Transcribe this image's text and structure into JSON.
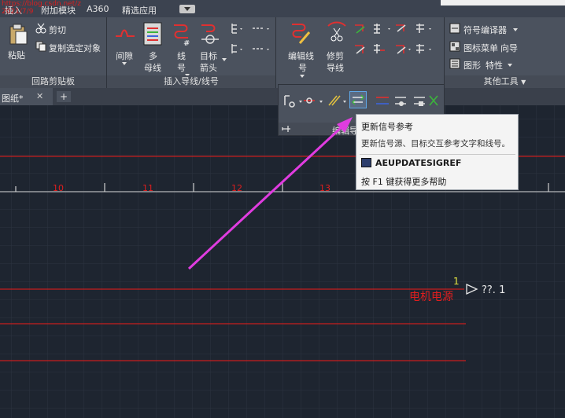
{
  "tabs": {
    "items": [
      "插入",
      "附加模块",
      "A360",
      "精选应用"
    ],
    "watermark_line1": "https://blog.csdn.net/z",
    "watermark_line2": "2021/7/9"
  },
  "ribbon": {
    "clipboard": {
      "paste": "粘贴",
      "cut": "剪切",
      "copy_selection": "复制选定对象",
      "title": "回路剪贴板"
    },
    "insert_wires": {
      "gap": "间隙",
      "multi_bus_1": "多",
      "multi_bus_2": "母线",
      "wire_1": "线",
      "wire_2": "号",
      "target_1": "目标",
      "target_2": "箭头",
      "title": "插入导线/线号"
    },
    "edit_wires": {
      "edit_wire_1": "编辑线",
      "edit_wire_2": "号",
      "trim_1": "修剪",
      "trim_2": "导线",
      "title": "编辑导线/线号"
    },
    "other_tools": {
      "symbol_builder": "符号编译器",
      "icon_menu": "图标菜单",
      "wizard": "向导",
      "properties_1": "图形",
      "properties_2": "特性",
      "title": "其他工具"
    }
  },
  "doc_tab": {
    "label": "图纸*",
    "close": "✕",
    "new": "+"
  },
  "flyout": {
    "title": "编辑导"
  },
  "tooltip": {
    "title": "更新信号参考",
    "description": "更新信号源、目标交互参考文字和线号。",
    "command": "AEUPDATESIGREF",
    "help": "按 F1 键获得更多帮助"
  },
  "drawing": {
    "column_numbers": [
      "10",
      "11",
      "12",
      "13"
    ],
    "wire_number": "1",
    "component_label": "电机电源",
    "signal_ref": "??. 1"
  },
  "colors": {
    "canvas_bg": "#1e2530",
    "ribbon_bg": "#4b525e",
    "red_line": "#c81e1e",
    "annotation_arrow": "#e03ce0",
    "tooltip_bg": "#f4f4f4"
  }
}
